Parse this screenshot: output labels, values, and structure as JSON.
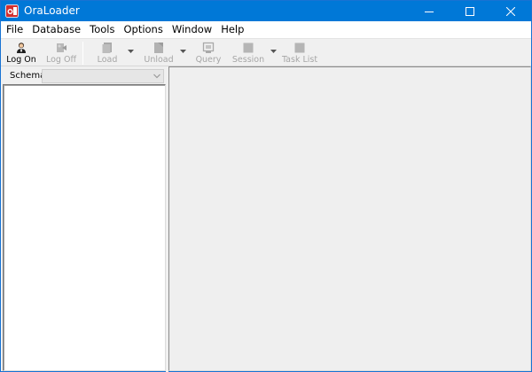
{
  "window": {
    "title": "OraLoader",
    "controls": {
      "minimize_icon": "minimize-icon",
      "maximize_icon": "maximize-icon",
      "close_icon": "close-icon"
    },
    "accent_color": "#0078d7"
  },
  "menubar": {
    "items": [
      {
        "label": "File"
      },
      {
        "label": "Database"
      },
      {
        "label": "Tools"
      },
      {
        "label": "Options"
      },
      {
        "label": "Window"
      },
      {
        "label": "Help"
      }
    ]
  },
  "toolbar": {
    "log_on": {
      "label": "Log On",
      "icon": "user-icon",
      "enabled": true
    },
    "log_off": {
      "label": "Log Off",
      "icon": "logoff-icon",
      "enabled": false
    },
    "load": {
      "label": "Load",
      "icon": "load-icon",
      "enabled": false,
      "has_dropdown": true
    },
    "unload": {
      "label": "Unload",
      "icon": "unload-icon",
      "enabled": false,
      "has_dropdown": true
    },
    "query": {
      "label": "Query",
      "icon": "query-icon",
      "enabled": false
    },
    "session": {
      "label": "Session",
      "icon": "session-icon",
      "enabled": false,
      "has_dropdown": true
    },
    "task_list": {
      "label": "Task List",
      "icon": "task-list-icon",
      "enabled": false
    }
  },
  "schema": {
    "label": "Schema",
    "selected_value": ""
  }
}
